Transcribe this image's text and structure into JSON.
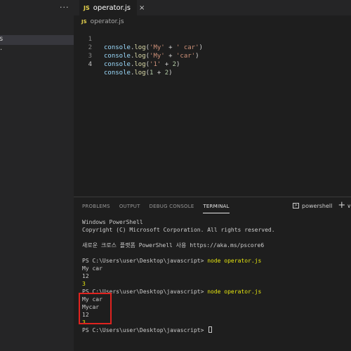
{
  "sidebar": {
    "more_label": "···",
    "selected_item_fragment": "s",
    "next_item_fragment": "·"
  },
  "tabs": [
    {
      "icon": "JS",
      "label": "operator.js",
      "close": "×"
    }
  ],
  "breadcrumb": {
    "icon": "JS",
    "file": "operator.js"
  },
  "editor": {
    "lines": [
      {
        "num": "1",
        "object": "console",
        "dot": ".",
        "method": "log",
        "open": "(",
        "left": "'My'",
        "op": " + ",
        "right": "' car'",
        "close": ")"
      },
      {
        "num": "2",
        "object": "console",
        "dot": ".",
        "method": "log",
        "open": "(",
        "left": "'My'",
        "op": " + ",
        "right": "'car'",
        "close": ")"
      },
      {
        "num": "3",
        "object": "console",
        "dot": ".",
        "method": "log",
        "open": "(",
        "left": "'1'",
        "op": " + ",
        "right": "2",
        "close": ")"
      },
      {
        "num": "4",
        "object": "console",
        "dot": ".",
        "method": "log",
        "open": "(",
        "left": "1",
        "op": " + ",
        "right": "2",
        "close": ")"
      }
    ]
  },
  "panel": {
    "tabs": [
      "PROBLEMS",
      "OUTPUT",
      "DEBUG CONSOLE",
      "TERMINAL"
    ],
    "active_tab": "TERMINAL",
    "terminal_name": "powershell",
    "new_terminal": "+",
    "dropdown": "∨"
  },
  "terminal": {
    "header1": "Windows PowerShell",
    "header2": "Copyright (C) Microsoft Corporation. All rights reserved.",
    "notice": "새로운 크로스 플랫폼 PowerShell 사용 https://aka.ms/pscore6",
    "prompt": "PS C:\\Users\\user\\Desktop\\javascript> ",
    "command": "node operator.js",
    "run1": [
      "My car",
      "12",
      "3"
    ],
    "run2": [
      "My car",
      "Mycar",
      "12",
      "3"
    ]
  }
}
